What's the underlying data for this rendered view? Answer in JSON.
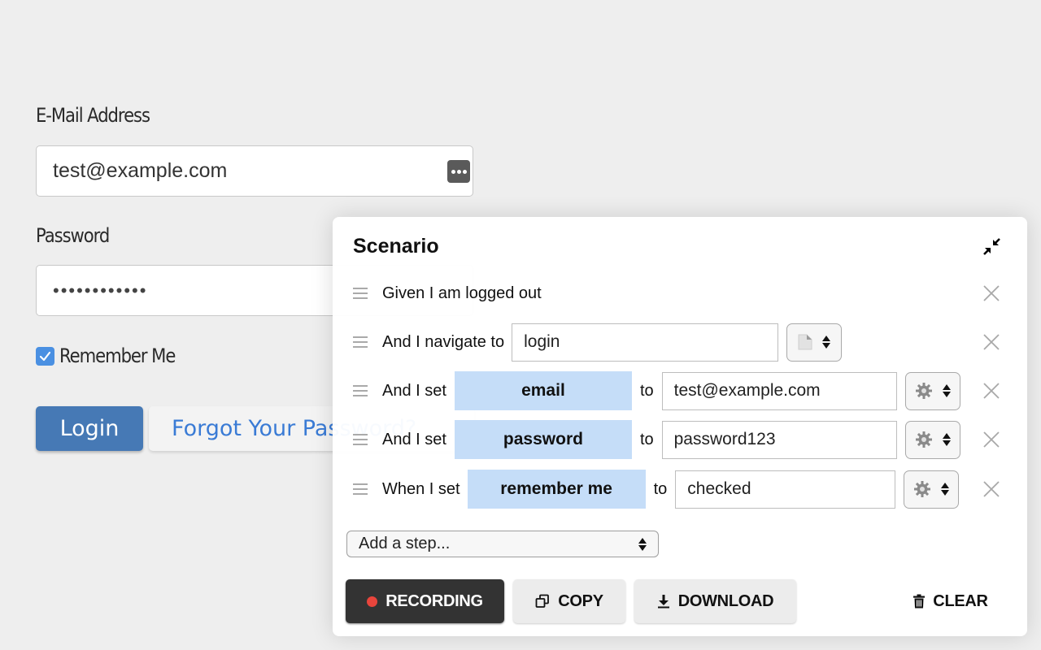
{
  "login_form": {
    "email_label": "E-Mail Address",
    "email_value": "test@example.com",
    "password_label": "Password",
    "password_value": "••••••••••••",
    "remember_label": "Remember Me",
    "remember_checked": true,
    "login_button": "Login",
    "forgot_button": "Forgot Your Password?"
  },
  "scenario_panel": {
    "title": "Scenario",
    "collapse_icon": "collapse-arrows-icon",
    "steps": [
      {
        "keyword": "Given I am logged out"
      },
      {
        "keyword": "And I navigate to",
        "value": "login",
        "type_icon": "page-icon"
      },
      {
        "keyword": "And I set",
        "target": "email",
        "to": "to",
        "value": "test@example.com",
        "type_icon": "gear-icon"
      },
      {
        "keyword": "And I set",
        "target": "password",
        "to": "to",
        "value": "password123",
        "type_icon": "gear-icon"
      },
      {
        "keyword": "When I set",
        "target": "remember me",
        "to": "to",
        "value": "checked",
        "type_icon": "gear-icon"
      }
    ],
    "add_step_placeholder": "Add a step...",
    "buttons": {
      "recording": "RECORDING",
      "copy": "COPY",
      "download": "DOWNLOAD",
      "clear": "CLEAR"
    }
  },
  "colors": {
    "background": "#eeeeee",
    "login_button": "#4679b5",
    "link_blue": "#3a7bd5",
    "checkbox_blue": "#4a90e2",
    "target_chip": "#c5ddf8",
    "recording_button": "#333333",
    "recording_dot": "#e8453c"
  }
}
